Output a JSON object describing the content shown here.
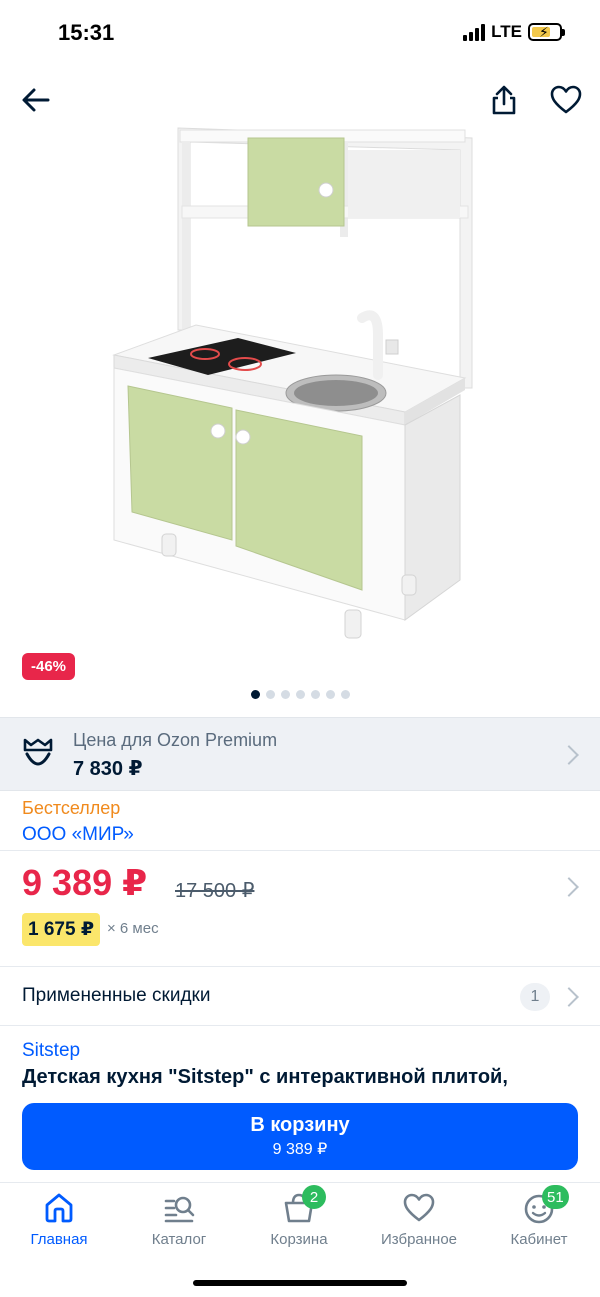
{
  "status_bar": {
    "time": "15:31",
    "network": "LTE"
  },
  "product": {
    "discount_badge": "-46%",
    "image_count": 7,
    "active_image": 1,
    "bestseller_label": "Бестселлер",
    "seller": "ООО «МИР»",
    "brand": "Sitstep",
    "title": "Детская кухня \"Sitstep\" с интерактивной плитой,"
  },
  "premium": {
    "title": "Цена для Ozon Premium",
    "price": "7 830 ₽"
  },
  "price": {
    "current": "9 389 ₽",
    "old": "17 500 ₽",
    "installment": "1 675 ₽",
    "installment_term": "× 6 мес"
  },
  "discounts": {
    "label": "Примененные скидки",
    "count": "1"
  },
  "cart_button": {
    "label": "В корзину",
    "price": "9 389 ₽"
  },
  "tabbar": {
    "items": [
      {
        "label": "Главная",
        "icon": "home-icon",
        "active": true
      },
      {
        "label": "Каталог",
        "icon": "catalog-icon"
      },
      {
        "label": "Корзина",
        "icon": "cart-icon",
        "badge": "2"
      },
      {
        "label": "Избранное",
        "icon": "heart-icon"
      },
      {
        "label": "Кабинет",
        "icon": "profile-icon",
        "badge": "51"
      }
    ]
  },
  "colors": {
    "accent": "#005bff",
    "sale": "#e8264a",
    "bestseller": "#f08a1d",
    "badge": "#2dbc5e",
    "installment": "#fbe66b"
  }
}
